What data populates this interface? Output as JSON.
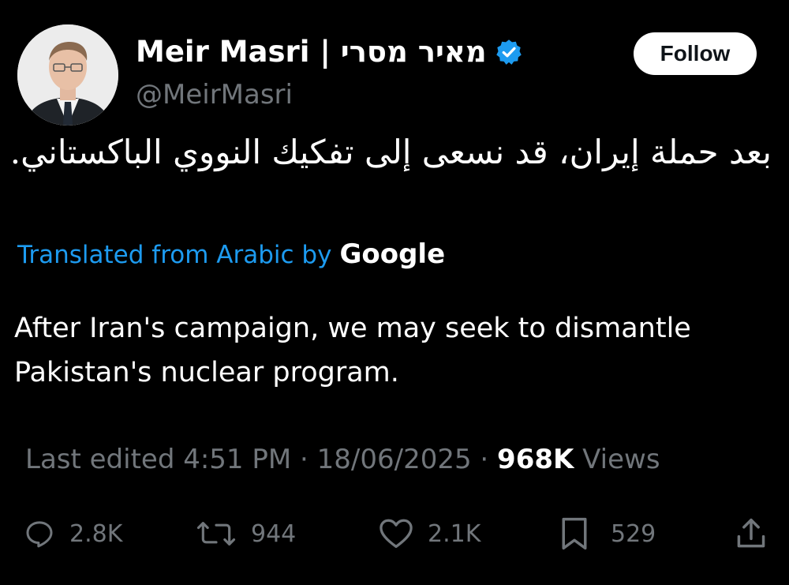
{
  "author": {
    "display_name": "Meir Masri | מאיר מסרי",
    "handle": "@MeirMasri",
    "verified": true,
    "verified_color": "#1d9bf0"
  },
  "follow_button": {
    "label": "Follow"
  },
  "tweet": {
    "original_text": "بعد حملة إيران، قد نسعى إلى تفكيك النووي الباكستاني.",
    "translation_label": "Translated from Arabic by",
    "translation_provider": "Google",
    "translated_text": "After Iran's campaign, we may seek to dismantle Pakistan's nuclear program."
  },
  "meta": {
    "edited_label": "Last edited 4:51 PM · 18/06/2025 ·",
    "views_count": "968K",
    "views_label": "Views"
  },
  "actions": {
    "replies": {
      "icon": "reply-icon",
      "count": "2.8K"
    },
    "reposts": {
      "icon": "repost-icon",
      "count": "944"
    },
    "likes": {
      "icon": "like-icon",
      "count": "2.1K"
    },
    "bookmarks": {
      "icon": "bookmark-icon",
      "count": "529"
    },
    "share": {
      "icon": "share-icon"
    }
  },
  "colors": {
    "background": "#000000",
    "primary_text": "#ffffff",
    "secondary_text": "#71767b",
    "link": "#1d9bf0"
  }
}
